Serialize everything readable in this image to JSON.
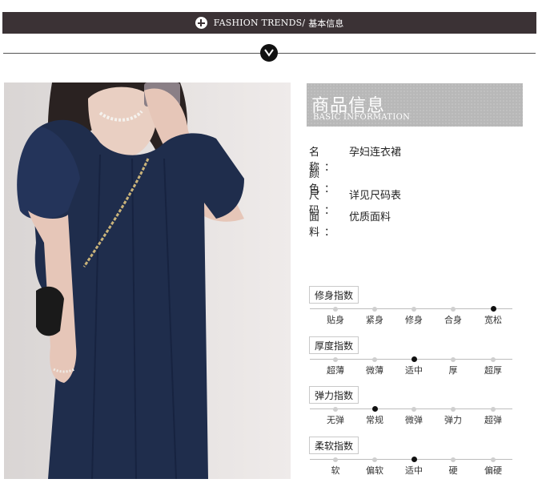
{
  "banner": {
    "title_en": "FASHION TRENDS/",
    "title_cn": "基本信息"
  },
  "info_header": {
    "title_cn": "商品信息",
    "title_en": "BASIC INFORMATION"
  },
  "specs": [
    {
      "label": "名 称：",
      "value": "孕妇连衣裙"
    },
    {
      "label": "颜 色：",
      "value": ""
    },
    {
      "label": "尺 码：",
      "value": "详见尺码表"
    },
    {
      "label": "面 料：",
      "value": "优质面料"
    }
  ],
  "indices": [
    {
      "title": "修身指数",
      "options": [
        "贴身",
        "紧身",
        "修身",
        "合身",
        "宽松"
      ],
      "selected": 4
    },
    {
      "title": "厚度指数",
      "options": [
        "超薄",
        "微薄",
        "适中",
        "厚",
        "超厚"
      ],
      "selected": 2
    },
    {
      "title": "弹力指数",
      "options": [
        "无弹",
        "常规",
        "微弹",
        "弹力",
        "超弹"
      ],
      "selected": 1
    },
    {
      "title": "柔软指数",
      "options": [
        "软",
        "偏软",
        "适中",
        "硬",
        "偏硬"
      ],
      "selected": 2
    }
  ],
  "colors": {
    "banner_bg": "#3b3235",
    "header_bg": "#b8b8b8",
    "dress": "#1f2d4c"
  },
  "icons": {
    "plus": "plus-circle-icon",
    "chevron": "chevron-down-icon"
  }
}
